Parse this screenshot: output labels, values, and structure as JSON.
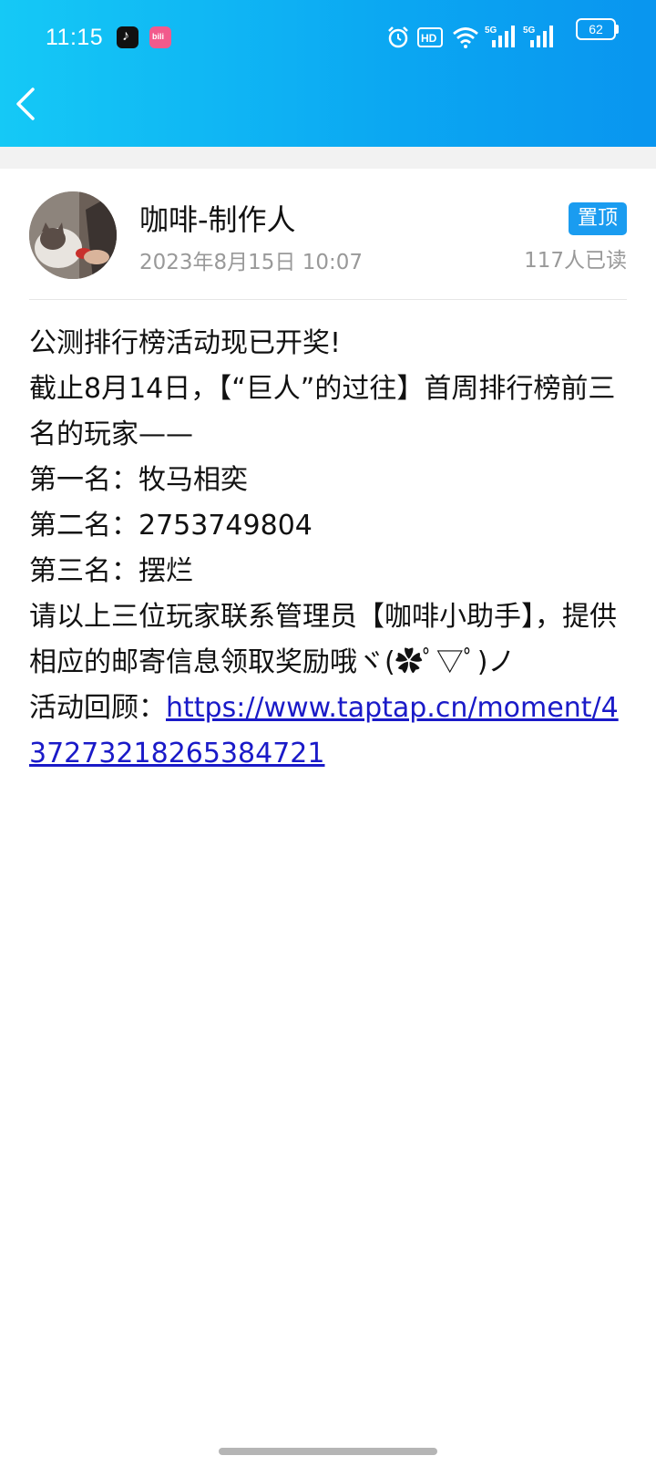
{
  "status_bar": {
    "time": "11:15",
    "battery": "62",
    "icons": [
      "tiktok-icon",
      "bilibili-icon",
      "alarm-icon",
      "hd-icon",
      "wifi-icon",
      "5g-signal-icon",
      "5g-signal-icon"
    ]
  },
  "header": {
    "back_icon": "chevron-left-icon",
    "background_color": "#0BA7F2"
  },
  "post": {
    "author": "咖啡-制作人",
    "date": "2023年8月15日 10:07",
    "pin_label": "置顶",
    "read_count": "117人已读",
    "lines": {
      "l1": "公测排行榜活动现已开奖!",
      "l2": "截止8月14日，【“巨人”的过往】首周排行榜前三名的玩家——",
      "l3": "第一名：牧马相奕",
      "l4": "第二名：2753749804",
      "l5": "第三名：摆烂",
      "l6": "请以上三位玩家联系管理员【咖啡小助手】，提供相应的邮寄信息领取奖励哦ヾ(✿ﾟ▽ﾟ)ノ",
      "l7_prefix": "活动回顾：",
      "l7_link": "https://www.taptap.cn/moment/437273218265384721"
    }
  },
  "colors": {
    "pin_badge": "#1A9CF0",
    "link": "#1A1AC8",
    "meta_text": "#999999"
  }
}
